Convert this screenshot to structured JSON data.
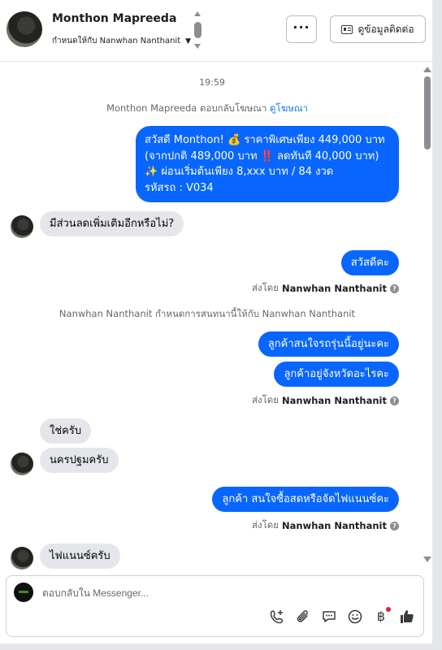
{
  "header": {
    "name": "Monthon Mapreeda",
    "assigned_text": "กำหนดให้กับ Nanwhan Nanthanit",
    "more_label": "···",
    "contact_label": "ดูข้อมูลติดต่อ"
  },
  "conversation": {
    "timestamp": "19:59",
    "ad_reply_text": "Monthon Mapreeda ตอบกลับโฆษณา",
    "ad_link": "ดูโฆษณา",
    "ad_message": [
      "สวัสดี Monthon! 💰 ราคาพิเศษเพียง 449,000 บาท",
      "(จากปกติ 489,000 บาท ‼️ ลดทันที 40,000 บาท)",
      "✨ ผ่อนเริ่มต้นเพียง 8,xxx บาท / 84 งวด",
      "รหัสรถ : V034"
    ],
    "msg_in_1": "มีส่วนลดเพิ่มเติมอีกหรือไม่?",
    "msg_out_1": "สวัสดีคะ",
    "sent_by_prefix": "ส่งโดย",
    "sent_by_name": "Nanwhan Nanthanit",
    "assign_system": "Nanwhan Nanthanit กำหนดการสนทนานี้ให้กับ Nanwhan Nanthanit",
    "msg_out_2": "ลูกค้าสนใจรถรุ่นนี้อยู่นะคะ",
    "msg_out_3": "ลูกค้าอยู่จังหวัดอะไรคะ",
    "msg_in_2": "ใช่ครับ",
    "msg_in_3": "นครปฐมครับ",
    "msg_out_4": "ลูกค้า สนใจซื้อสดหรือจัดไฟแนนซ์คะ",
    "msg_in_4": "ไฟแนนซ์ครับ"
  },
  "composer": {
    "placeholder": "ตอบกลับใน Messenger...",
    "value": ""
  },
  "colors": {
    "outgoing_bubble": "#0866ff",
    "incoming_bubble": "#e4e6eb",
    "link": "#1877f2",
    "muted_text": "#65676b"
  },
  "icons": [
    "add-call-icon",
    "paperclip-icon",
    "saved-reply-icon",
    "emoji-icon",
    "baht-payment-icon",
    "thumbs-up-icon"
  ]
}
